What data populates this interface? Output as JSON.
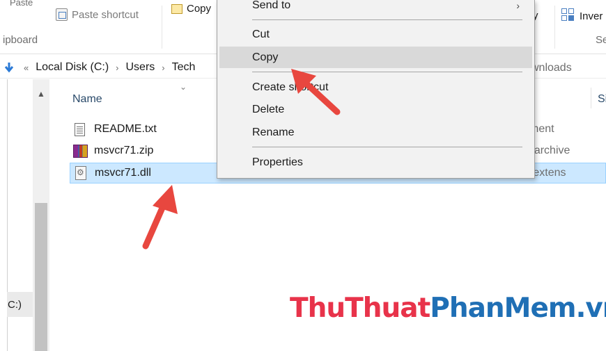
{
  "ribbon": {
    "paste_label": "Paste",
    "paste_shortcut_label": "Paste shortcut",
    "copy_label": "Copy",
    "clipboard_label": "ipboard",
    "invert_label": "Inver",
    "select_label": "Se",
    "partial_right_label": "y"
  },
  "address": {
    "prefix": "«",
    "crumbs": [
      "Local Disk (C:)",
      "Users",
      "Tech"
    ],
    "right_fragment": "wnloads"
  },
  "nav": {
    "item_label": "C:)"
  },
  "columns": {
    "name": "Name",
    "size": "Si"
  },
  "files": [
    {
      "name": "README.txt",
      "type": "ment",
      "icon": "text-file-icon"
    },
    {
      "name": "msvcr71.zip",
      "type": "P archive",
      "icon": "winrar-archive-icon"
    },
    {
      "name": "msvcr71.dll",
      "type": "n extens",
      "icon": "dll-file-icon",
      "selected": true
    }
  ],
  "context_menu": {
    "send_to": "Send to",
    "cut": "Cut",
    "copy": "Copy",
    "create_shortcut": "Create shortcut",
    "delete": "Delete",
    "rename": "Rename",
    "properties": "Properties"
  },
  "watermark": {
    "part1": "ThuThuat",
    "part2": "PhanMem.vn"
  },
  "colors": {
    "selection_bg": "#cce8ff",
    "menu_bg": "#f2f2f2",
    "arrow": "#e8473f",
    "watermark_red": "#e8334a",
    "watermark_blue": "#1f6fb5"
  }
}
